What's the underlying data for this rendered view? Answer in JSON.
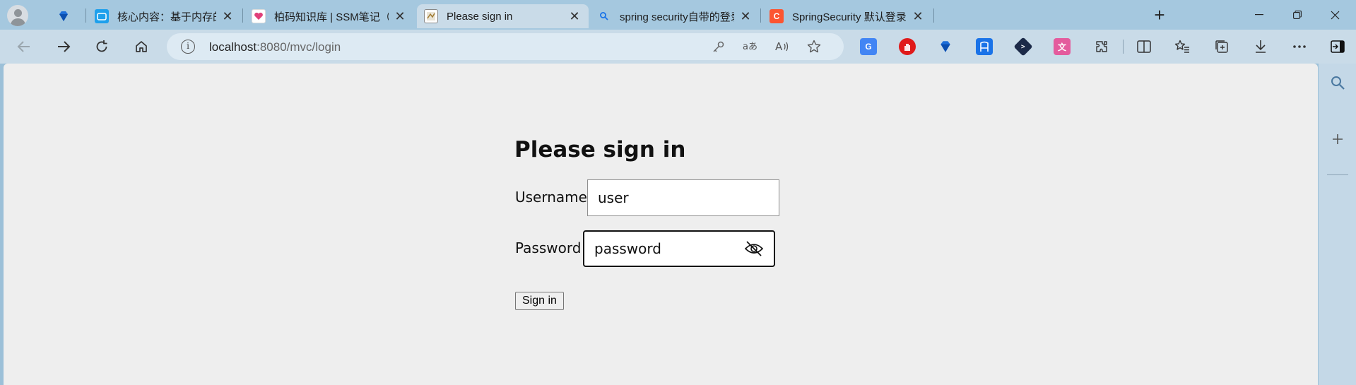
{
  "browser": {
    "tabs": [
      {
        "title": "",
        "favicon": "diamond-icon",
        "close": ""
      },
      {
        "title": "核心内容：基于内存的校验_哔哩",
        "favicon": "bilibili-icon",
        "close": "✕"
      },
      {
        "title": "柏码知识库 | SSM笔记（三）Spri",
        "favicon": "heart-icon",
        "close": "✕"
      },
      {
        "title": "Please sign in",
        "favicon": "page-icon",
        "close": "✕"
      },
      {
        "title": "spring security自带的登录界面 进",
        "favicon": "search-icon",
        "close": "✕"
      },
      {
        "title": "SpringSecurity 默认登录页面加载",
        "favicon": "csdn-icon",
        "close": "✕"
      }
    ],
    "new_tab": "+",
    "window_controls": {
      "minimize": "—",
      "restore": "❐",
      "close": "✕"
    },
    "address": {
      "host": "localhost",
      "rest": ":8080/mvc/login"
    },
    "accent": "#a5c8df"
  },
  "form": {
    "heading": "Please sign in",
    "username_label": "Username",
    "username_value": "user",
    "password_label": "Password",
    "password_value": "password",
    "submit_label": "Sign in"
  }
}
